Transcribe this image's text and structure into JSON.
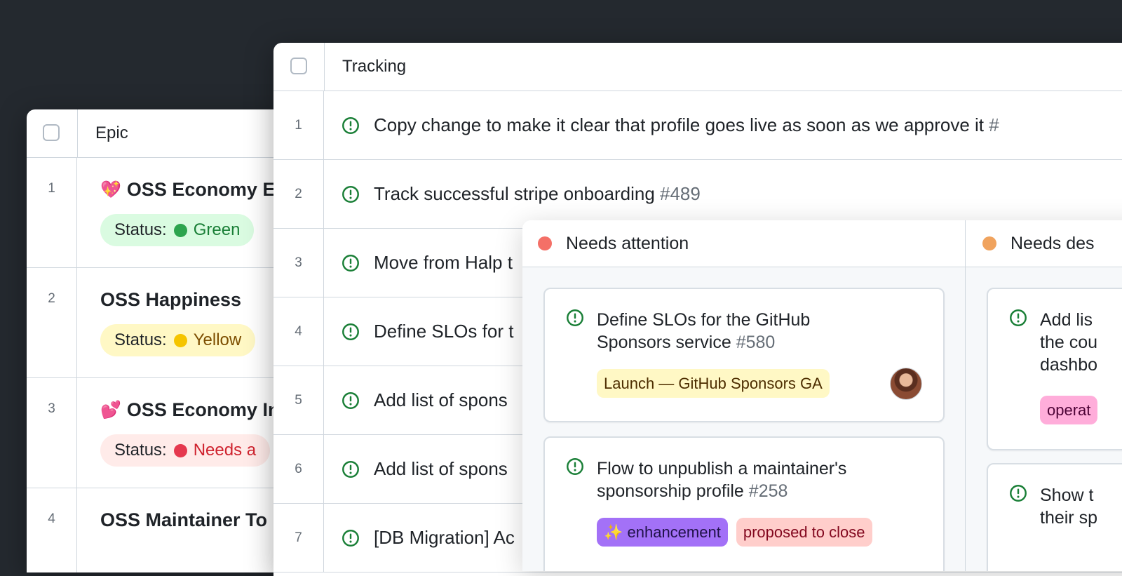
{
  "epic_table": {
    "header": "Epic",
    "rows": [
      {
        "num": "1",
        "emoji": "💖",
        "title": "OSS Economy E",
        "status_label": "Status:",
        "status_value": "Green",
        "status_color": "#2da44e"
      },
      {
        "num": "2",
        "emoji": "",
        "title": "OSS Happiness",
        "status_label": "Status:",
        "status_value": "Yellow",
        "status_color": "#f5c400"
      },
      {
        "num": "3",
        "emoji": "💕",
        "title": "OSS Economy In",
        "status_label": "Status:",
        "status_value": "Needs a",
        "status_color": "#e5384e"
      },
      {
        "num": "4",
        "emoji": "",
        "title": "OSS Maintainer To",
        "status_label": "",
        "status_value": "",
        "status_color": ""
      }
    ]
  },
  "tracking_table": {
    "header": "Tracking",
    "rows": [
      {
        "num": "1",
        "title": "Copy change to make it clear that profile goes live as soon as we approve it",
        "issue": "#"
      },
      {
        "num": "2",
        "title": "Track successful stripe onboarding",
        "issue": "#489"
      },
      {
        "num": "3",
        "title": "Move from Halp t",
        "issue": ""
      },
      {
        "num": "4",
        "title": "Define SLOs for t",
        "issue": ""
      },
      {
        "num": "5",
        "title": "Add list of spons",
        "issue": ""
      },
      {
        "num": "6",
        "title": "Add list of spons",
        "issue": ""
      },
      {
        "num": "7",
        "title": "[DB Migration] Ac",
        "issue": ""
      }
    ]
  },
  "board": {
    "columns": [
      {
        "name": "Needs attention",
        "dot_color": "#f47067"
      },
      {
        "name": "Needs des",
        "dot_color": "#f0a35e"
      }
    ],
    "cards": [
      {
        "col": 0,
        "title_lines": [
          "Define SLOs for the GitHub",
          "Sponsors service"
        ],
        "issue": "#580",
        "labels": [
          "Launch — GitHub Sponsors GA"
        ],
        "has_avatar": true
      },
      {
        "col": 0,
        "title_lines": [
          "Flow to unpublish a maintainer's",
          "sponsorship profile"
        ],
        "issue": "#258",
        "labels": [
          "✨ enhancement",
          "proposed to close"
        ],
        "has_avatar": false
      },
      {
        "col": 1,
        "title_lines": [
          "Add lis",
          "the cou",
          "dashbo"
        ],
        "issue": "",
        "labels": [
          "operat"
        ],
        "has_avatar": false
      },
      {
        "col": 1,
        "title_lines": [
          "Show t",
          "their sp"
        ],
        "issue": "",
        "labels": [],
        "has_avatar": false
      }
    ]
  },
  "colors": {
    "background": "#24292f",
    "issue_open_green": "#1a7f37"
  },
  "icons": {
    "issue": "issue-opened-icon"
  }
}
